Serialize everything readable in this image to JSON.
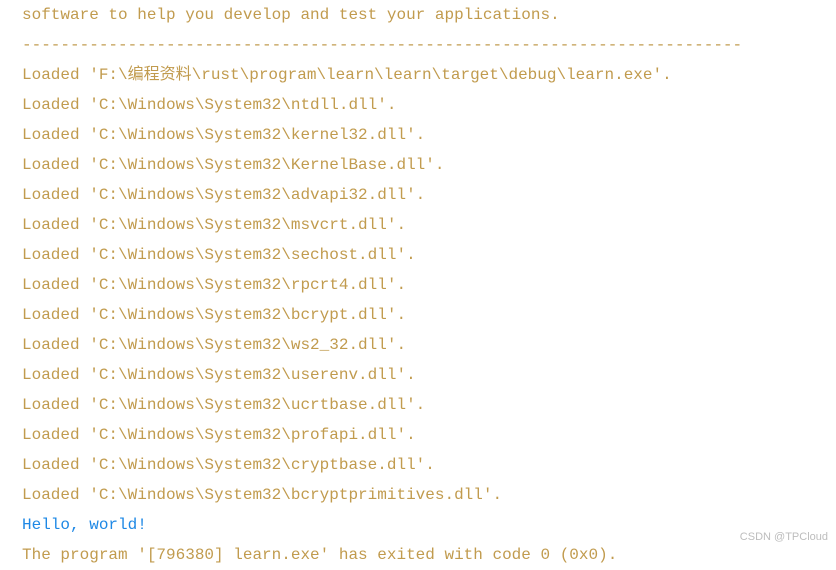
{
  "lines": [
    {
      "text": "software to help you develop and test your applications.",
      "color": "orange"
    },
    {
      "text": "---------------------------------------------------------------------------",
      "color": "orange"
    },
    {
      "text": "Loaded 'F:\\编程资料\\rust\\program\\learn\\learn\\target\\debug\\learn.exe'.",
      "color": "orange"
    },
    {
      "text": "Loaded 'C:\\Windows\\System32\\ntdll.dll'.",
      "color": "orange"
    },
    {
      "text": "Loaded 'C:\\Windows\\System32\\kernel32.dll'.",
      "color": "orange"
    },
    {
      "text": "Loaded 'C:\\Windows\\System32\\KernelBase.dll'.",
      "color": "orange"
    },
    {
      "text": "Loaded 'C:\\Windows\\System32\\advapi32.dll'.",
      "color": "orange"
    },
    {
      "text": "Loaded 'C:\\Windows\\System32\\msvcrt.dll'.",
      "color": "orange"
    },
    {
      "text": "Loaded 'C:\\Windows\\System32\\sechost.dll'.",
      "color": "orange"
    },
    {
      "text": "Loaded 'C:\\Windows\\System32\\rpcrt4.dll'.",
      "color": "orange"
    },
    {
      "text": "Loaded 'C:\\Windows\\System32\\bcrypt.dll'.",
      "color": "orange"
    },
    {
      "text": "Loaded 'C:\\Windows\\System32\\ws2_32.dll'.",
      "color": "orange"
    },
    {
      "text": "Loaded 'C:\\Windows\\System32\\userenv.dll'.",
      "color": "orange"
    },
    {
      "text": "Loaded 'C:\\Windows\\System32\\ucrtbase.dll'.",
      "color": "orange"
    },
    {
      "text": "Loaded 'C:\\Windows\\System32\\profapi.dll'.",
      "color": "orange"
    },
    {
      "text": "Loaded 'C:\\Windows\\System32\\cryptbase.dll'.",
      "color": "orange"
    },
    {
      "text": "Loaded 'C:\\Windows\\System32\\bcryptprimitives.dll'.",
      "color": "orange"
    },
    {
      "text": "Hello, world!",
      "color": "blue"
    },
    {
      "text": "The program '[796380] learn.exe' has exited with code 0 (0x0).",
      "color": "orange"
    }
  ],
  "watermark": "CSDN @TPCloud"
}
